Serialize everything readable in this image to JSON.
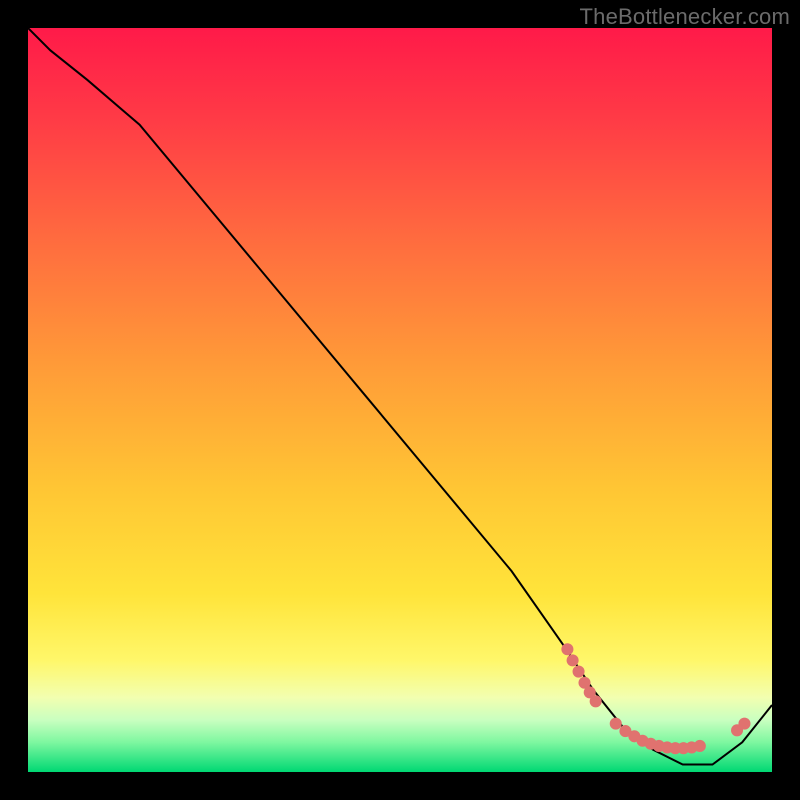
{
  "watermark": "TheBottlenecker.com",
  "chart_data": {
    "type": "line",
    "title": "",
    "xlabel": "",
    "ylabel": "",
    "xlim": [
      0,
      100
    ],
    "ylim": [
      0,
      100
    ],
    "background_gradient": {
      "type": "vertical_heat",
      "top_color": "#ff1744",
      "mid_color": "#ffe73b",
      "bottom_band_color": "#00e676"
    },
    "series": [
      {
        "name": "curve",
        "x": [
          0,
          3,
          8,
          15,
          25,
          35,
          45,
          55,
          65,
          72,
          76,
          80,
          84,
          88,
          92,
          96,
          100
        ],
        "y": [
          100,
          97,
          93,
          87,
          75,
          63,
          51,
          39,
          27,
          17,
          11,
          6,
          3,
          1,
          1,
          4,
          9
        ]
      }
    ],
    "highlight_dots": {
      "name": "optimal_zone_dots",
      "color": "#e0726f",
      "size": 12,
      "points": [
        {
          "x": 72.5,
          "y": 16.5
        },
        {
          "x": 73.2,
          "y": 15.0
        },
        {
          "x": 74.0,
          "y": 13.5
        },
        {
          "x": 74.8,
          "y": 12.0
        },
        {
          "x": 75.5,
          "y": 10.7
        },
        {
          "x": 76.3,
          "y": 9.5
        },
        {
          "x": 79.0,
          "y": 6.5
        },
        {
          "x": 80.3,
          "y": 5.5
        },
        {
          "x": 81.5,
          "y": 4.8
        },
        {
          "x": 82.6,
          "y": 4.2
        },
        {
          "x": 83.7,
          "y": 3.8
        },
        {
          "x": 84.8,
          "y": 3.5
        },
        {
          "x": 85.9,
          "y": 3.3
        },
        {
          "x": 87.0,
          "y": 3.2
        },
        {
          "x": 88.1,
          "y": 3.2
        },
        {
          "x": 89.2,
          "y": 3.3
        },
        {
          "x": 90.3,
          "y": 3.5
        },
        {
          "x": 95.3,
          "y": 5.6
        },
        {
          "x": 96.3,
          "y": 6.5
        }
      ]
    }
  }
}
